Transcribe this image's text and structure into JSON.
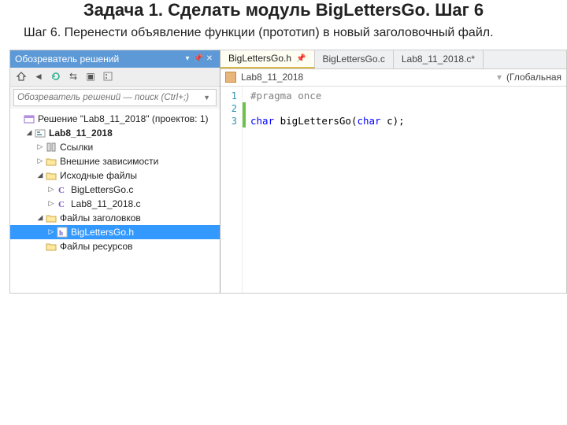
{
  "slide": {
    "title": "Задача 1. Сделать модуль BigLettersGo. Шаг 6",
    "instruction": "Шаг 6. Перенести объявление функции (прототип) в новый заголовочный файл."
  },
  "solution_explorer": {
    "panel_title": "Обозреватель решений",
    "search_placeholder": "Обозреватель решений — поиск (Ctrl+;)",
    "tree": {
      "solution": "Решение \"Lab8_11_2018\" (проектов: 1)",
      "project": "Lab8_11_2018",
      "refs": "Ссылки",
      "ext_deps": "Внешние зависимости",
      "src_folder": "Исходные файлы",
      "src1": "BigLettersGo.c",
      "src2": "Lab8_11_2018.c",
      "hdr_folder": "Файлы заголовков",
      "hdr1": "BigLettersGo.h",
      "res_folder": "Файлы ресурсов"
    }
  },
  "editor": {
    "tabs": [
      {
        "label": "BigLettersGo.h",
        "active": true,
        "pinned": true
      },
      {
        "label": "BigLettersGo.c",
        "active": false
      },
      {
        "label": "Lab8_11_2018.c*",
        "active": false
      }
    ],
    "nav": {
      "project": "Lab8_11_2018",
      "scope": "(Глобальная"
    },
    "code": {
      "line1": "#pragma once",
      "line2_kw1": "char",
      "line2_id": " bigLettersGo(",
      "line2_kw2": "char",
      "line2_rest": " c);"
    },
    "line_numbers": [
      "1",
      "2",
      "3"
    ]
  }
}
